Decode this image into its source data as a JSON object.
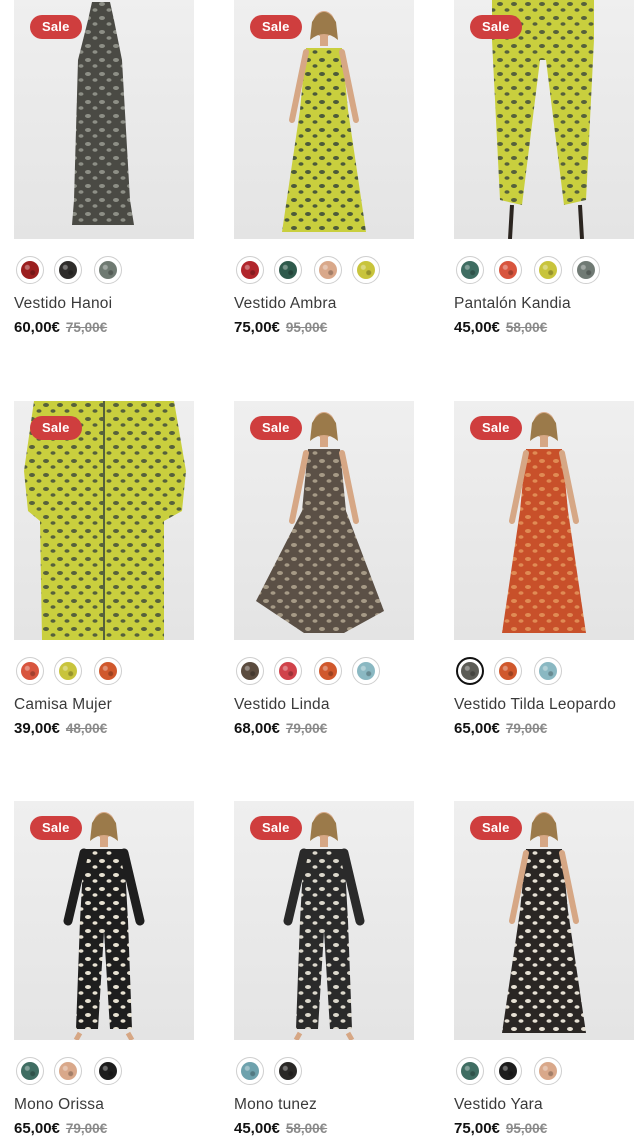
{
  "sale_label": "Sale",
  "products": [
    {
      "name": "Vestido Hanoi",
      "price": "60,00€",
      "old_price": "75,00€",
      "swatches": [
        "#9b1f1f",
        "#2f2d2b",
        "#6f7a72"
      ],
      "selected_swatch": -1
    },
    {
      "name": "Vestido Ambra",
      "price": "75,00€",
      "old_price": "95,00€",
      "swatches": [
        "#b1262c",
        "#2f5a4c",
        "#d9a88a",
        "#c8c43c"
      ],
      "selected_swatch": -1
    },
    {
      "name": "Pantalón Kandia",
      "price": "45,00€",
      "old_price": "58,00€",
      "swatches": [
        "#3f6d62",
        "#d8553e",
        "#c8c43c",
        "#707a74"
      ],
      "selected_swatch": -1
    },
    {
      "name": "Camisa Mujer",
      "price": "39,00€",
      "old_price": "48,00€",
      "swatches": [
        "#d8553e",
        "#c8c43c",
        "#d0582c"
      ],
      "selected_swatch": -1
    },
    {
      "name": "Vestido Linda",
      "price": "68,00€",
      "old_price": "79,00€",
      "swatches": [
        "#5b4c3f",
        "#d0424a",
        "#d0582c",
        "#8ab8c2"
      ],
      "selected_swatch": -1
    },
    {
      "name": "Vestido Tilda Leopardo",
      "price": "65,00€",
      "old_price": "79,00€",
      "swatches": [
        "#5c5c56",
        "#d0582c",
        "#8ab8c2"
      ],
      "selected_swatch": 0
    },
    {
      "name": "Mono Orissa",
      "price": "65,00€",
      "old_price": "79,00€",
      "swatches": [
        "#3f6d62",
        "#d9a88a",
        "#1d1d1d"
      ],
      "selected_swatch": -1
    },
    {
      "name": "Mono tunez",
      "price": "45,00€",
      "old_price": "58,00€",
      "swatches": [
        "#6ea2ad",
        "#2a2826"
      ],
      "selected_swatch": -1
    },
    {
      "name": "Vestido Yara",
      "price": "75,00€",
      "old_price": "95,00€",
      "swatches": [
        "#3f6d62",
        "#1d1d1d",
        "#d9a88a"
      ],
      "selected_swatch": -1
    }
  ],
  "garment_colors": [
    "#4a4a44",
    "#c9cf3e",
    "#c9cf3e",
    "#c9cf3e",
    "#5b5046",
    "#c8502a",
    "#1e1e1e",
    "#2a2a2a",
    "#2a2624"
  ],
  "pattern_colors": [
    "#8d8f86",
    "#4c5a3a",
    "#56613c",
    "#56613c",
    "#a69a86",
    "#e08b54",
    "#e8e2d2",
    "#dcd8cc",
    "#e6e0d4"
  ],
  "skin_color": "#d6a785",
  "hair_color": "#9b7a4a"
}
